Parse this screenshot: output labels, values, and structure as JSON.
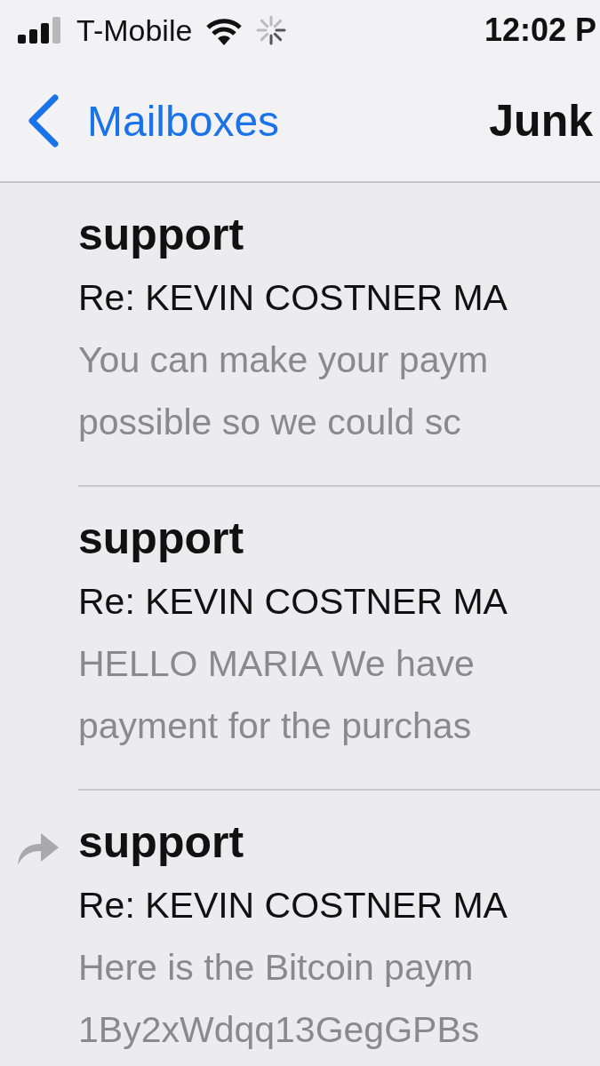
{
  "status_bar": {
    "carrier": "T-Mobile",
    "time": "12:02 P"
  },
  "nav_bar": {
    "back_label": "Mailboxes",
    "title": "Junk"
  },
  "messages": [
    {
      "sender": "support",
      "subject": "Re: KEVIN COSTNER MA",
      "preview_lines": [
        "You can make your paym",
        "possible so we could sc"
      ],
      "replied": false
    },
    {
      "sender": "support",
      "subject": "Re: KEVIN COSTNER MA",
      "preview_lines": [
        "HELLO MARIA We have",
        "payment for the purchas"
      ],
      "replied": false
    },
    {
      "sender": "support",
      "subject": "Re: KEVIN COSTNER MA",
      "preview_lines": [
        "Here is the Bitcoin paym",
        "1By2xWdqq13GegGPBs"
      ],
      "replied": true
    }
  ]
}
